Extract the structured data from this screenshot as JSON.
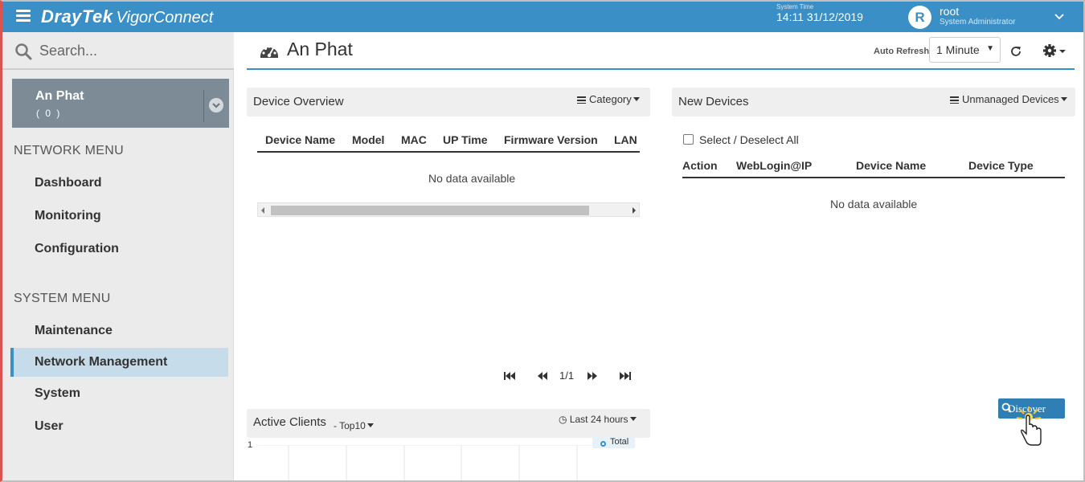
{
  "app": {
    "brand_primary": "DrayTek",
    "brand_secondary": "VigorConnect",
    "system_time_label": "System Time",
    "system_time": "14:11 31/12/2019",
    "user": {
      "initial": "R",
      "name": "root",
      "role": "System Administrator"
    },
    "accent_color": "#3a8fc6"
  },
  "sidebar": {
    "search_placeholder": "Search...",
    "site": {
      "name": "An Phat",
      "count": "( 0 )"
    },
    "network_menu_heading": "NETWORK MENU",
    "network_items": [
      {
        "label": "Dashboard"
      },
      {
        "label": "Monitoring"
      },
      {
        "label": "Configuration"
      }
    ],
    "system_menu_heading": "SYSTEM MENU",
    "system_items": [
      {
        "label": "Maintenance",
        "active": false
      },
      {
        "label": "Network Management",
        "active": true
      },
      {
        "label": "System",
        "active": false
      },
      {
        "label": "User",
        "active": false
      }
    ]
  },
  "header": {
    "title": "An Phat",
    "auto_refresh_label": "Auto Refresh:",
    "auto_refresh_value": "1 Minute"
  },
  "device_overview": {
    "title": "Device Overview",
    "menu_label": "Category",
    "columns": [
      "Device Name",
      "Model",
      "MAC",
      "UP Time",
      "Firmware Version",
      "LAN"
    ],
    "empty_text": "No data available",
    "pager": {
      "text": "1/1"
    }
  },
  "new_devices": {
    "title": "New Devices",
    "menu_label": "Unmanaged Devices",
    "select_all_label": "Select / Deselect All",
    "columns": [
      "Action",
      "WebLogin@IP",
      "Device Name",
      "Device Type"
    ],
    "empty_text": "No data available",
    "discover_label": "Discover"
  },
  "active_clients": {
    "title": "Active Clients",
    "filter_label": "- Top10",
    "range_label": "Last 24 hours",
    "y_tick": "1",
    "legend_label": "Total"
  }
}
